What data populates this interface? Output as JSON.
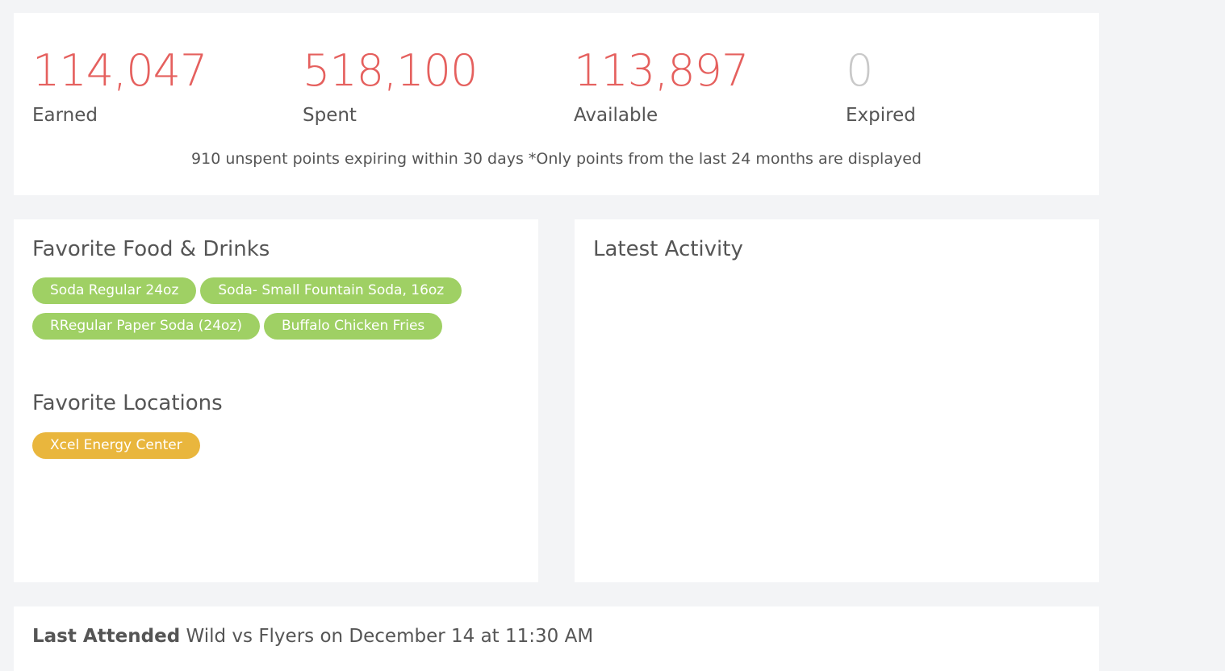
{
  "points": {
    "earned": {
      "value": "114,047",
      "label": "Earned"
    },
    "spent": {
      "value": "518,100",
      "label": "Spent"
    },
    "available": {
      "value": "113,897",
      "label": "Available"
    },
    "expired": {
      "value": "0",
      "label": "Expired"
    },
    "note": "910 unspent points expiring within 30 days *Only points from the last 24 months are displayed"
  },
  "favorites": {
    "food_title": "Favorite Food & Drinks",
    "food_items": [
      "Soda Regular 24oz",
      "Soda- Small Fountain Soda, 16oz",
      "RRegular Paper Soda (24oz)",
      "Buffalo Chicken Fries"
    ],
    "locations_title": "Favorite Locations",
    "locations": [
      "Xcel Energy Center"
    ]
  },
  "activity": {
    "title": "Latest Activity"
  },
  "last_attended": {
    "label": "Last Attended",
    "value": "Wild vs Flyers on December 14 at 11:30 AM"
  },
  "colors": {
    "accent_red": "#e5605e",
    "muted_gray": "#c9c9c9",
    "food_tag_green": "#9fd064",
    "location_tag_gold": "#e9b63d"
  }
}
